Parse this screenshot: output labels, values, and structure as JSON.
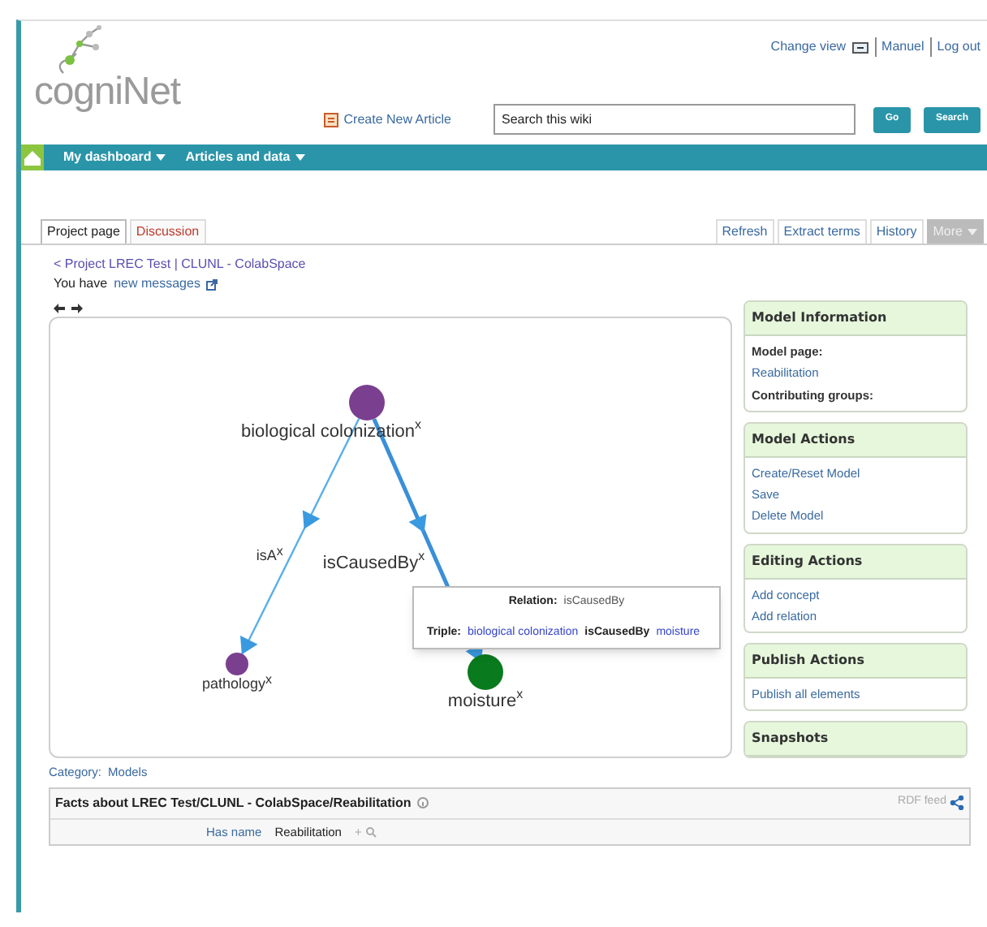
{
  "header": {
    "logo": "cogniNet",
    "links": [
      "Change view",
      "Manuel",
      "Log out"
    ],
    "create_article": "Create New Article",
    "search": {
      "placeholder": "Search this wiki"
    },
    "buttons": [
      "Go",
      "Search"
    ]
  },
  "nav": [
    "My dashboard",
    "Articles and data"
  ],
  "tabs": [
    {
      "label": "Project page",
      "selected": true
    },
    {
      "label": "Discussion",
      "selected": false
    }
  ],
  "actions": [
    {
      "label": "Refresh",
      "disabled": false
    },
    {
      "label": "Extract terms",
      "disabled": false
    },
    {
      "label": "History",
      "disabled": false
    },
    {
      "label": "More",
      "disabled": true
    }
  ],
  "breadcrumb": "< Project LREC Test | CLUNL - ColabSpace",
  "messages": {
    "prefix": "You have",
    "link": "new messages"
  },
  "graph": {
    "nodes": [
      {
        "label": "biological colonization",
        "remove": "x",
        "color": "#7b3f8f"
      },
      {
        "label": "pathology",
        "remove": "x",
        "color": "#7b3f8f"
      },
      {
        "label": "moisture",
        "remove": "x",
        "color": "#0a7a1e"
      }
    ],
    "edges": [
      {
        "label": "isA",
        "remove": "x",
        "selected": false
      },
      {
        "label": "isCausedBy",
        "remove": "x",
        "selected": true
      }
    ],
    "tooltip": {
      "relation_label": "Relation:",
      "relation": "isCausedBy",
      "triple_label": "Triple:",
      "subject": "biological colonization",
      "predicate": "isCausedBy",
      "object": "moisture"
    }
  },
  "category": {
    "label": "Category:",
    "value": "Models"
  },
  "sidebar": [
    {
      "title": "Model Information",
      "items": [
        {
          "kind": "label",
          "text": "Model page:"
        },
        {
          "kind": "link",
          "text": "Reabilitation"
        },
        {
          "kind": "label",
          "text": "Contributing groups:"
        }
      ]
    },
    {
      "title": "Model Actions",
      "items": [
        {
          "kind": "link",
          "text": "Create/Reset Model"
        },
        {
          "kind": "link",
          "text": "Save"
        },
        {
          "kind": "link",
          "text": "Delete Model"
        }
      ]
    },
    {
      "title": "Editing Actions",
      "items": [
        {
          "kind": "link",
          "text": "Add concept"
        },
        {
          "kind": "link",
          "text": "Add relation"
        }
      ]
    },
    {
      "title": "Publish Actions",
      "items": [
        {
          "kind": "link",
          "text": "Publish all elements"
        }
      ]
    },
    {
      "title": "Snapshots"
    }
  ],
  "facts": {
    "title": "Facts about LREC Test/CLUNL - ColabSpace/Reabilitation",
    "feed": "RDF feed",
    "rows": [
      {
        "property": "Has name",
        "value": "Reabilitation",
        "add": "+"
      }
    ]
  }
}
